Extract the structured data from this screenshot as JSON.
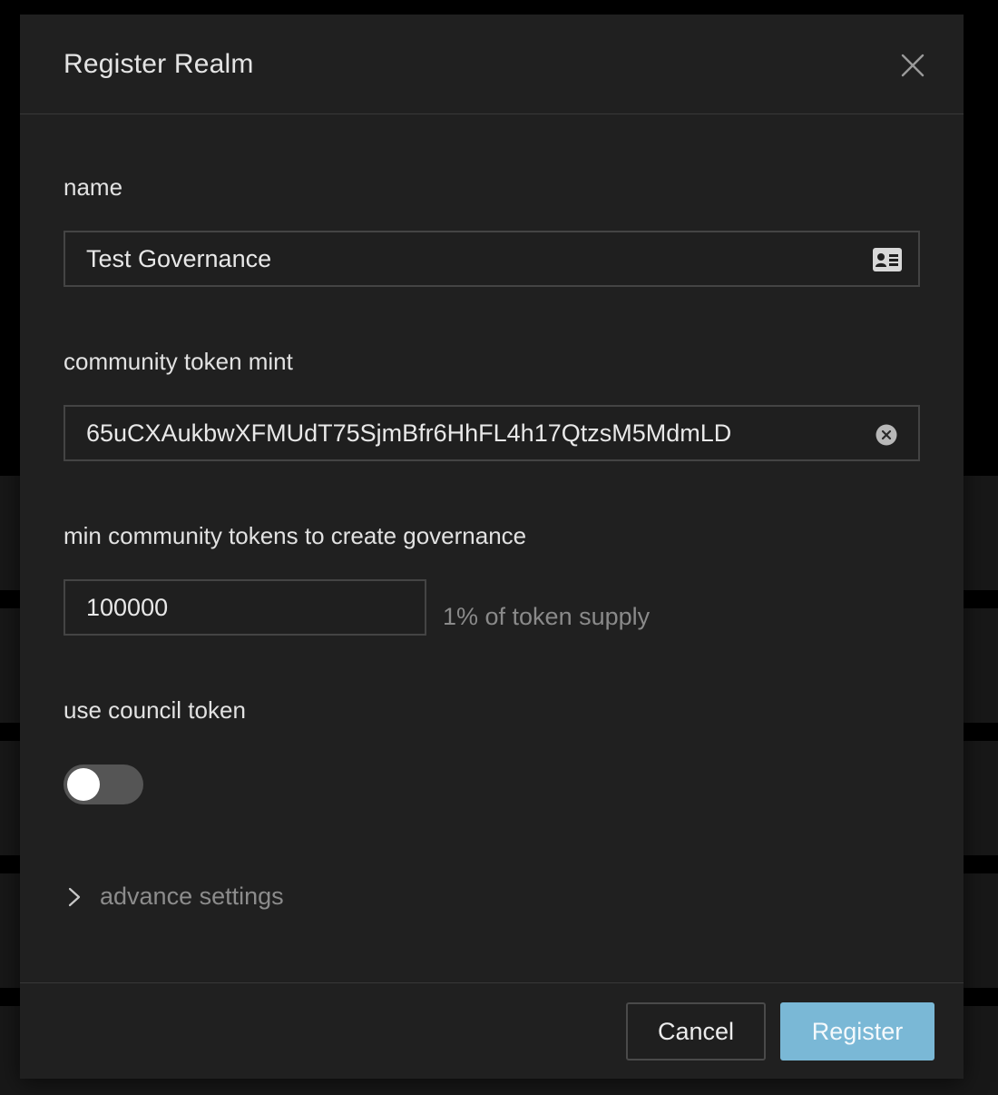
{
  "modal": {
    "title": "Register Realm"
  },
  "fields": {
    "name": {
      "label": "name",
      "value": "Test Governance",
      "icon": "contact-card-icon"
    },
    "community_mint": {
      "label": "community token mint",
      "value": "65uCXAukbwXFMUdT75SjmBfr6HhFL4h17QtzsM5MdmLD",
      "icon": "clear-circle-icon"
    },
    "min_tokens": {
      "label": "min community tokens to create governance",
      "value": "100000",
      "hint": "1% of token supply"
    },
    "council": {
      "label": "use council token",
      "enabled": false
    }
  },
  "advanced": {
    "label": "advance settings",
    "icon": "chevron-right-icon"
  },
  "footer": {
    "cancel_label": "Cancel",
    "register_label": "Register"
  },
  "colors": {
    "background": "#000000",
    "modal": "#202020",
    "accent": "#7ab8d6",
    "muted_text": "#8a8a8a"
  }
}
